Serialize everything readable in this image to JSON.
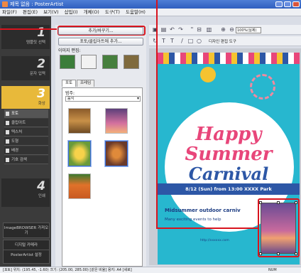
{
  "titlebar": {
    "title": "제목 없음 : PosterArtist"
  },
  "menu": [
    "파일(F)",
    "편집(E)",
    "보기(V)",
    "삽입(I)",
    "개체(O)",
    "도구(T)",
    "도움말(H)"
  ],
  "steps": [
    {
      "num": "1",
      "label": "템플릿 선택"
    },
    {
      "num": "2",
      "label": "문자 입력"
    },
    {
      "num": "3",
      "label": "화상"
    },
    {
      "num": "4",
      "label": "인쇄"
    }
  ],
  "step3_items": [
    "포토",
    "클립아트",
    "텍스처",
    "도형",
    "배경",
    "기호 검색"
  ],
  "bottom_items": [
    "ImageBROWSER\n가져오기",
    "디지털 카메라",
    "PosterArtist\n설정"
  ],
  "midpanel": {
    "add_button": "추가/바꾸기...",
    "add_from_file": "포토/클립아트에 추가...",
    "image_edit_label": "이미지 편집:",
    "tabs": [
      "포토",
      "프레임"
    ],
    "category_label": "범주:",
    "category_value": "음식"
  },
  "toolbar": {
    "zoom": "100%(실제)",
    "text_tools": "디자인 편집 도구"
  },
  "poster": {
    "title_line1": "Happy",
    "title_line2": "Summer",
    "title_line3": "Carnival",
    "date": "8/12 (Sun) from 13:00  XXXX Park",
    "subtitle": "Midsummer outdoor carniv",
    "subtitle2": "Many exciting events to help",
    "url": "http://xxxxxx.com"
  },
  "status": {
    "text": "[포토] 위치: (195.45, -1.60) 크기: (205.00, 285.00) [같은 비율]  용지: A4 [세로]",
    "num": "NUM"
  },
  "colors": {
    "accent": "#d8141e",
    "step_active": "#e8b93a",
    "poster_bg": "#27b7cf",
    "date_bar": "#2d57a6",
    "title_pink": "#e8467a"
  }
}
